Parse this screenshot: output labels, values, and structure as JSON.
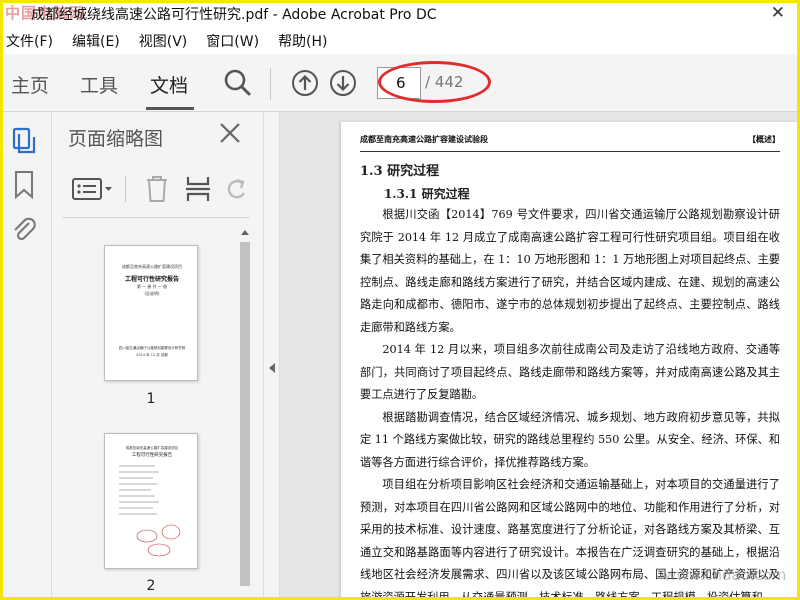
{
  "window": {
    "title": "成都经城绕线高速公路可行性研究.pdf - Adobe Acrobat Pro DC",
    "watermark": "中国电脑网",
    "close_glyph": "✕"
  },
  "menu": [
    "文件(F)",
    "编辑(E)",
    "视图(V)",
    "窗口(W)",
    "帮助(H)"
  ],
  "toolbar": {
    "tabs": [
      "主页",
      "工具",
      "文档"
    ],
    "active_tab": "文档",
    "page_current": "6",
    "page_total": "/ 442"
  },
  "panel": {
    "title": "页面缩略图",
    "thumbnails": [
      {
        "label": "1",
        "lines": [
          "成都至南充高速公路扩容建设项目",
          "工程可行性研究报告",
          "第 一 册 共 一 册",
          "(总说明)"
        ],
        "footer": [
          "四川省交通运输厅公路规划勘察设计研究院",
          "2014 年 12 月  成都"
        ]
      },
      {
        "label": "2",
        "lines": [
          "成都至南充高速公路扩容建设项目",
          "工程可行性研究报告"
        ],
        "footer": []
      }
    ]
  },
  "document": {
    "header_left": "成都至南充高速公路扩容建设试验段",
    "header_right": "【概述】",
    "section_title": "1.3 研究过程",
    "subsection_title": "1.3.1 研究过程",
    "paragraphs": [
      "根据川交函【2014】769 号文件要求，四川省交通运输厅公路规划勘察设计研究院于 2014 年 12 月成立了成南高速公路扩容工程可行性研究项目组。项目组在收集了相关资料的基础上，在 1：10 万地形图和 1：1 万地形图上对项目起终点、主要控制点、路线走廊和路线方案进行了研究，并结合区域内建成、在建、规划的高速公路走向和成都市、德阳市、遂宁市的总体规划初步提出了起终点、主要控制点、路线走廊带和路线方案。",
      "2014 年 12 月以来，项目组多次前往成南公司及走访了沿线地方政府、交通等部门，共同商讨了项目起终点、路线走廊带和路线方案等，并对成南高速公路及其主要工点进行了反复踏勘。",
      "根据踏勘调查情况，结合区域经济情况、城乡规划、地方政府初步意见等，共拟定 11 个路线方案做比较，研究的路线总里程约 550 公里。从安全、经济、环保、和谐等各方面进行综合评价，择优推荐路线方案。",
      "项目组在分析项目影响区社会经济和交通运输基础上，对本项目的交通量进行了预测，对本项目在四川省公路网和区域公路网中的地位、功能和作用进行了分析，对采用的技术标准、设计速度、路基宽度进行了分析论证，对各路线方案及其桥梁、互通立交和路基路面等内容进行了研究设计。本报告在广泛调查研究的基础上，根据沿线地区社会经济发展需求、四川省以及该区域公路网布局、国土资源和矿产资源以及旅游资源开发利用，从交通量预测、技术标准、路线方案、工程规模、投资估算和"
    ],
    "site_watermark": "www.chdao.com"
  },
  "colors": {
    "frame_border": "#f3e600",
    "toolbar_bg": "#f4f4f4",
    "highlight_oval": "#e12c2c",
    "rail_icon_active": "#2a6fc9"
  }
}
